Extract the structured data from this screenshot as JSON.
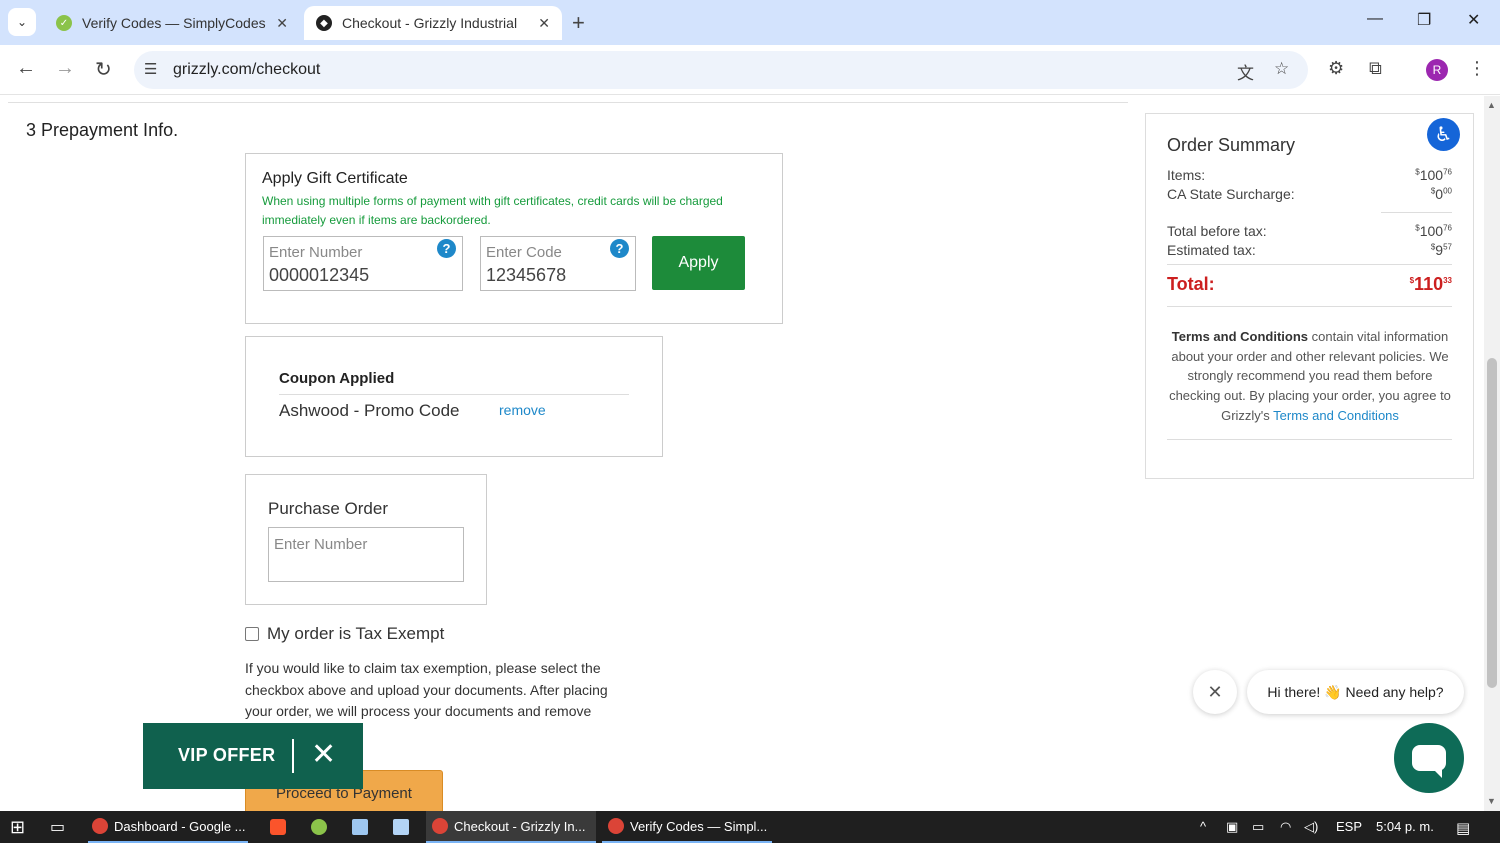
{
  "browser": {
    "tabs": [
      {
        "title": "Verify Codes — SimplyCodes",
        "active": false
      },
      {
        "title": "Checkout - Grizzly Industrial",
        "active": true
      }
    ],
    "url": "grizzly.com/checkout",
    "profile_initial": "R"
  },
  "checkout": {
    "step_title": "3 Prepayment Info.",
    "gift": {
      "title": "Apply Gift Certificate",
      "note": "When using multiple forms of payment with gift certificates, credit cards will be charged immediately even if items are backordered.",
      "number_placeholder": "Enter Number",
      "number_value": "0000012345",
      "code_placeholder": "Enter Code",
      "code_value": "12345678",
      "apply_label": "Apply",
      "help_glyph": "?"
    },
    "coupon": {
      "title": "Coupon Applied",
      "code": "Ashwood - Promo Code",
      "remove_label": "remove"
    },
    "purchase_order": {
      "title": "Purchase Order",
      "placeholder": "Enter Number"
    },
    "tax_exempt": {
      "label": "My order is Tax Exempt",
      "checked": false,
      "text": "If you would like to claim tax exemption, please select the checkbox above and upload your documents. After placing your order, we will process your documents and remove"
    },
    "proceed_label": "Proceed to Payment",
    "vip_label": "VIP OFFER"
  },
  "summary": {
    "title": "Order Summary",
    "items_label": "Items:",
    "items_whole": "100",
    "items_cents": "76",
    "surcharge_label": "CA State Surcharge:",
    "surcharge_whole": "0",
    "surcharge_cents": "00",
    "before_tax_label": "Total before tax:",
    "before_tax_whole": "100",
    "before_tax_cents": "76",
    "tax_label": "Estimated tax:",
    "tax_whole": "9",
    "tax_cents": "57",
    "total_label": "Total:",
    "total_whole": "110",
    "total_cents": "33",
    "currency": "$",
    "terms_bold": "Terms and Conditions",
    "terms_text": " contain vital information about your order and other relevant policies. We strongly recommend you read them before checking out. By placing your order, you agree to Grizzly's ",
    "terms_link": "Terms and Conditions"
  },
  "chat": {
    "greeting": "Hi there! 👋 Need any help?"
  },
  "taskbar": {
    "items": [
      "Dashboard - Google ...",
      "Checkout - Grizzly In...",
      "Verify Codes — Simpl..."
    ],
    "language": "ESP",
    "time": "5:04 p. m."
  },
  "colors": {
    "accent_green": "#1d8b3a",
    "note_green": "#169b3c",
    "total_red": "#cc1f1f",
    "link_blue": "#1e88c9",
    "vip_bg": "#10614e",
    "proceed_bg": "#f0a84a"
  }
}
